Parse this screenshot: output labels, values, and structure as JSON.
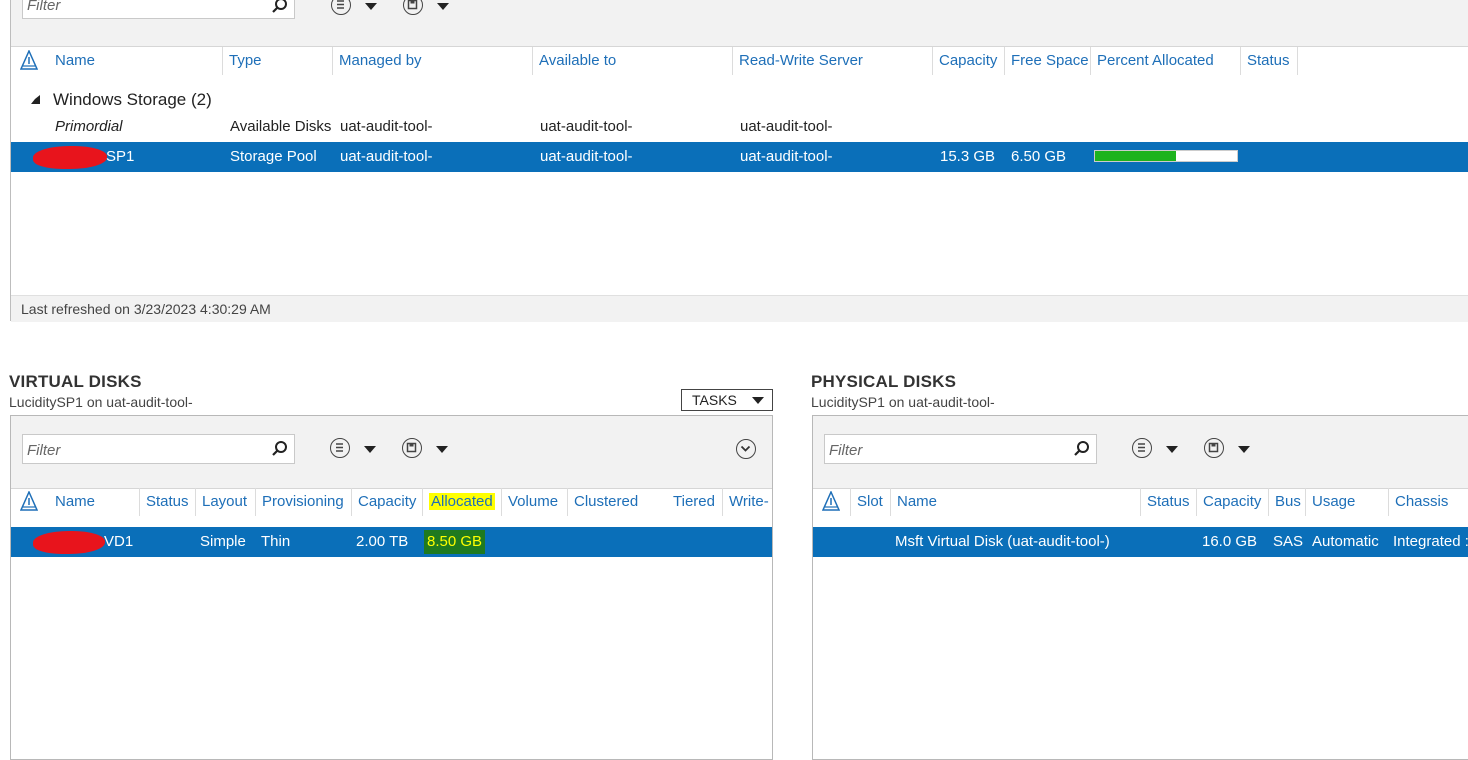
{
  "pools": {
    "filter_placeholder": "Filter",
    "columns": [
      "Name",
      "Type",
      "Managed by",
      "Available to",
      "Read-Write Server",
      "Capacity",
      "Free Space",
      "Percent Allocated",
      "Status"
    ],
    "group": {
      "label": "Windows Storage (2)"
    },
    "rows": [
      {
        "name": "Primordial",
        "type": "Available Disks",
        "managed_by": "uat-audit-tool-",
        "available_to": "uat-audit-tool-",
        "rw_server": "uat-audit-tool-",
        "capacity": "",
        "free_space": ""
      },
      {
        "name": "SP1",
        "type": "Storage Pool",
        "managed_by": "uat-audit-tool-",
        "available_to": "uat-audit-tool-",
        "rw_server": "uat-audit-tool-",
        "capacity": "15.3 GB",
        "free_space": "6.50 GB",
        "percent_allocated": 0.57
      }
    ],
    "status_bar": "Last refreshed on 3/23/2023 4:30:29 AM"
  },
  "virtual_disks": {
    "title": "VIRTUAL DISKS",
    "subtitle": "LuciditySP1 on uat-audit-tool-",
    "tasks_label": "TASKS",
    "filter_placeholder": "Filter",
    "columns": [
      "Name",
      "Status",
      "Layout",
      "Provisioning",
      "Capacity",
      "Allocated",
      "Volume",
      "Clustered",
      "Tiered",
      "Write-"
    ],
    "rows": [
      {
        "name": "VD1",
        "status": "",
        "layout": "Simple",
        "provisioning": "Thin",
        "capacity": "2.00 TB",
        "allocated": "8.50 GB"
      }
    ]
  },
  "physical_disks": {
    "title": "PHYSICAL DISKS",
    "subtitle": "LuciditySP1 on uat-audit-tool-",
    "filter_placeholder": "Filter",
    "columns": [
      "Slot",
      "Name",
      "Status",
      "Capacity",
      "Bus",
      "Usage",
      "Chassis"
    ],
    "rows": [
      {
        "slot": "",
        "name": "Msft Virtual Disk (uat-audit-tool-)",
        "status": "",
        "capacity": "16.0 GB",
        "bus": "SAS",
        "usage": "Automatic",
        "chassis": "Integrated :"
      }
    ]
  },
  "colors": {
    "selection": "#0a6fb9",
    "header_text": "#1e6fb8",
    "progress_fill": "#1db31d",
    "highlight": "#ffff00",
    "highlight_dark": "#1f7a1f",
    "redaction": "#e8141c"
  },
  "icons": [
    "search-icon",
    "list-view-icon",
    "save-icon",
    "chevron-down-icon",
    "warning-icon",
    "collapse-triangle-icon",
    "caret-down-icon"
  ]
}
